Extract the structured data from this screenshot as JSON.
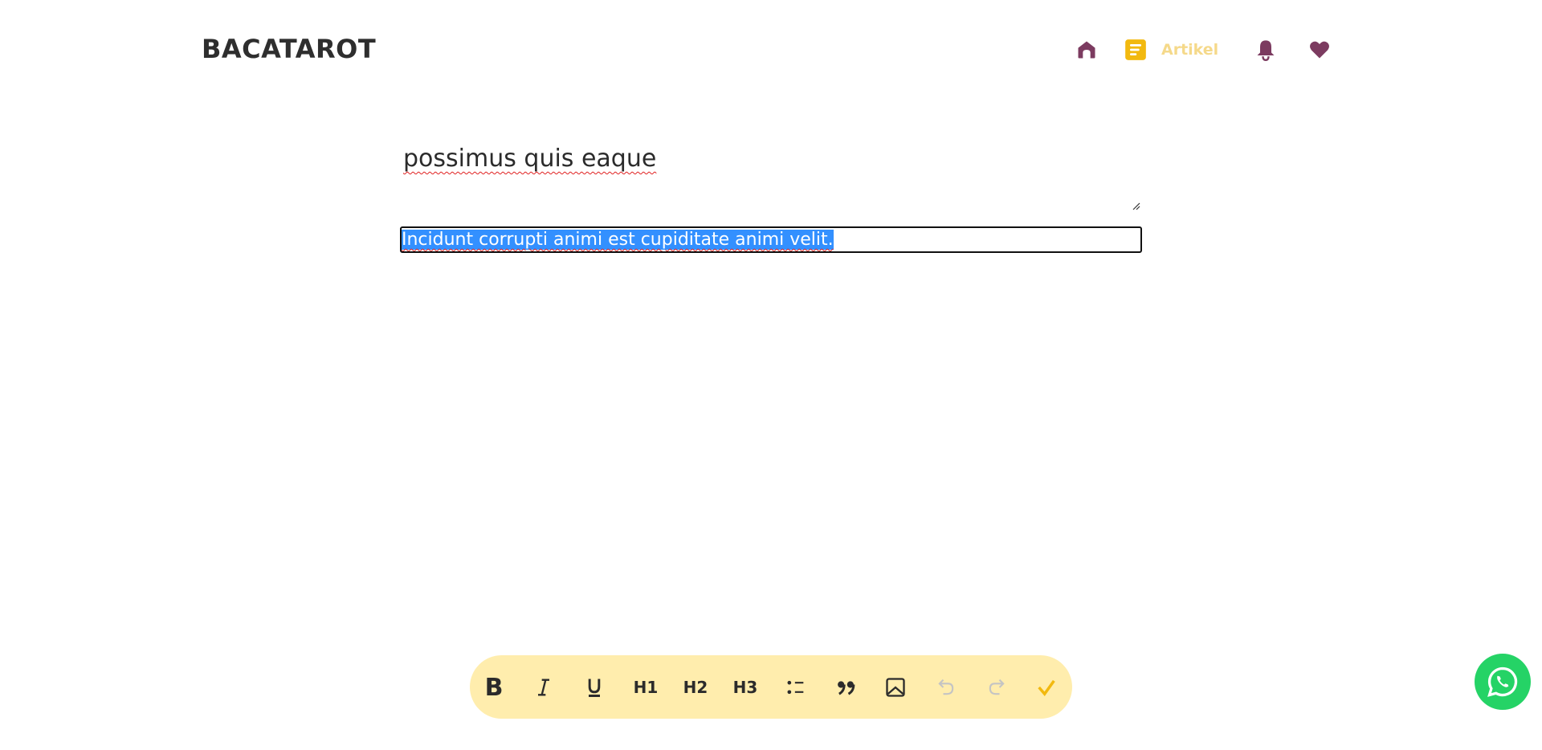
{
  "header": {
    "logo": "BACATAROT",
    "nav": {
      "artikel_label": "Artikel"
    }
  },
  "editor": {
    "title_value": "possimus quis eaque",
    "content_value": "Incidunt corrupti animi est cupiditate animi velit."
  },
  "toolbar": {
    "bold": "B",
    "h1": "H1",
    "h2": "H2",
    "h3": "H3"
  },
  "colors": {
    "accent": "#F2B90F",
    "nav_icon": "#7C3B60",
    "toolbar_bg": "#FFEDAD",
    "whatsapp": "#25D366",
    "selection": "#3390FF"
  }
}
